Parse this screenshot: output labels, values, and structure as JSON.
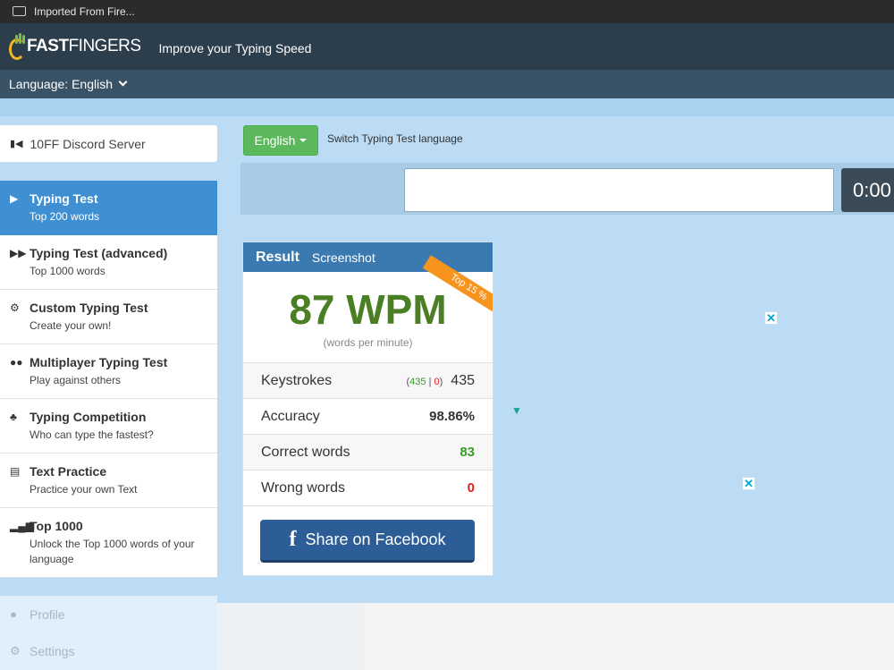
{
  "browser": {
    "bookmark_folder": "Imported From Fire..."
  },
  "header": {
    "logo_bold": "FAST",
    "logo_light": "FINGERS",
    "tagline": "Improve your Typing Speed"
  },
  "language_bar": {
    "label": "Language: English"
  },
  "sidebar": {
    "discord": "10FF Discord Server",
    "items": [
      {
        "title": "Typing Test",
        "subtitle": "Top 200 words",
        "icon": "play-icon"
      },
      {
        "title": "Typing Test (advanced)",
        "subtitle": "Top 1000 words",
        "icon": "fast-forward-icon"
      },
      {
        "title": "Custom Typing Test",
        "subtitle": "Create your own!",
        "icon": "gears-icon"
      },
      {
        "title": "Multiplayer Typing Test",
        "subtitle": "Play against others",
        "icon": "users-icon"
      },
      {
        "title": "Typing Competition",
        "subtitle": "Who can type the fastest?",
        "icon": "trophy-icon"
      },
      {
        "title": "Text Practice",
        "subtitle": "Practice your own Text",
        "icon": "document-icon"
      },
      {
        "title": "Top 1000",
        "subtitle": "Unlock the Top 1000 words of your language",
        "icon": "signal-icon"
      }
    ],
    "secondary": [
      {
        "label": "Profile",
        "icon": "user-icon"
      },
      {
        "label": "Settings",
        "icon": "gear-icon"
      }
    ]
  },
  "language_select": {
    "button": "English",
    "switch_label": "Switch Typing Test language"
  },
  "test": {
    "input_value": "",
    "timer": "0:00"
  },
  "result": {
    "title": "Result",
    "screenshot_link": "Screenshot",
    "badge": "Top 15 %",
    "wpm": "87 WPM",
    "wpm_caption": "(words per minute)",
    "keystrokes_label": "Keystrokes",
    "keystrokes_correct": "435",
    "keystrokes_wrong": "0",
    "keystrokes_total": "435",
    "accuracy_label": "Accuracy",
    "accuracy_value": "98.86%",
    "correct_label": "Correct words",
    "correct_value": "83",
    "wrong_label": "Wrong words",
    "wrong_value": "0",
    "share_button": "Share on Facebook"
  },
  "colors": {
    "header": "#2c3d4c",
    "active_nav": "#3f8fd2",
    "wpm_green": "#4a7f23",
    "facebook": "#2d5d96",
    "badge": "#f7941d"
  }
}
